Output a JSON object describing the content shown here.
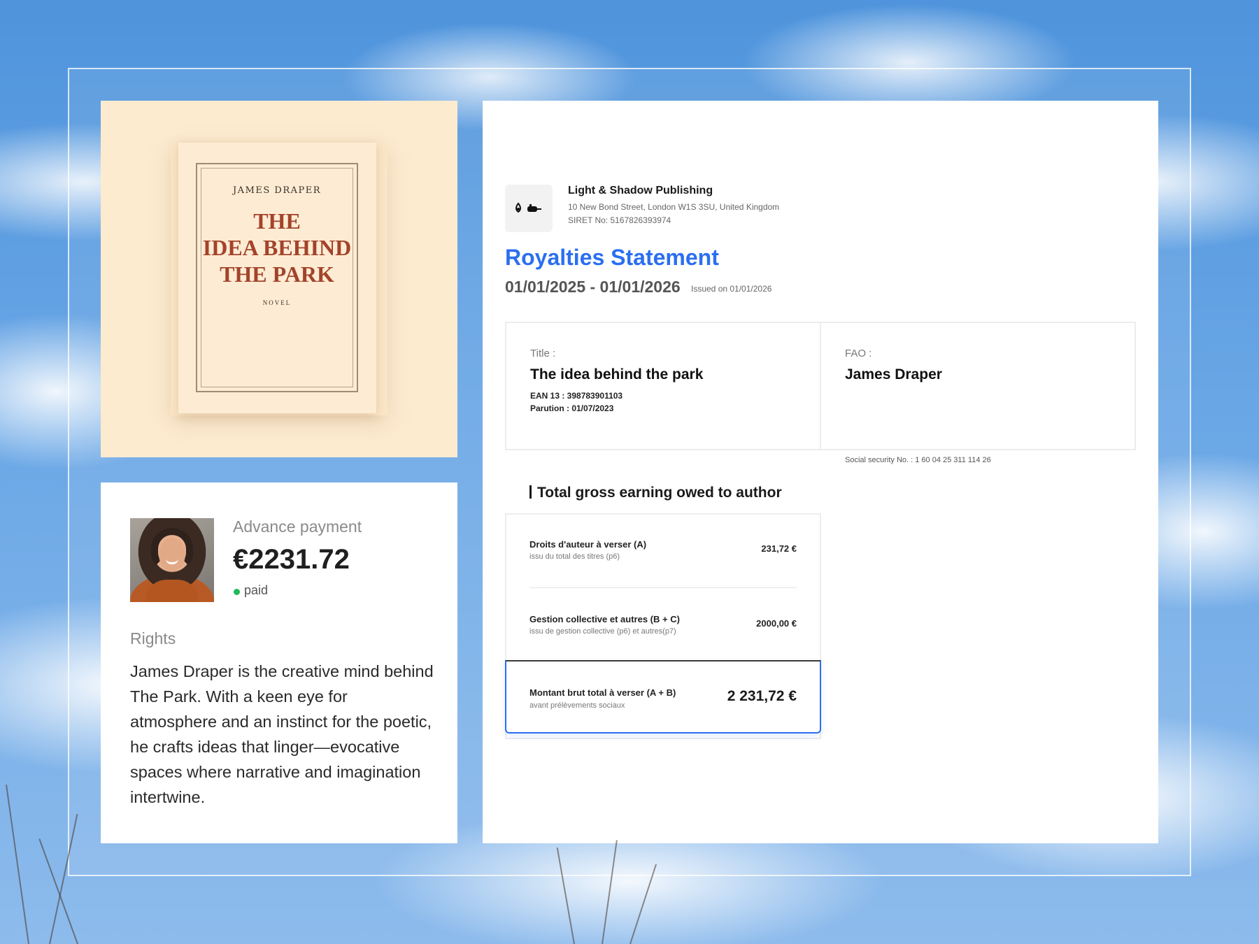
{
  "book": {
    "author": "JAMES DRAPER",
    "title": "THE\nIDEA BEHIND\nTHE PARK",
    "genre": "NOVEL"
  },
  "advance": {
    "label": "Advance payment",
    "amount": "€2231.72",
    "status": "paid",
    "status_color": "#22b95a"
  },
  "rights": {
    "label": "Rights",
    "text": "James Draper is the creative mind behind The Park. With a keen eye for atmosphere and an instinct for the poetic, he crafts ideas that linger—evocative spaces where narrative and imagination intertwine."
  },
  "publisher": {
    "name": "Light & Shadow Publishing",
    "address": "10 New Bond Street, London W1S 3SU, United Kingdom",
    "siret": "SIRET No: 5167826393974"
  },
  "statement": {
    "title": "Royalties Statement",
    "period": "01/01/2025 - 01/01/2026",
    "issued": "Issued on 01/01/2026",
    "accent_color": "#2b6ff0"
  },
  "title_card": {
    "label": "Title :",
    "value": "The idea behind the park",
    "ean": "EAN 13 : 398783901103",
    "parution": "Parution : 01/07/2023"
  },
  "fao_card": {
    "label": "FAO :",
    "value": "James Draper",
    "ssn": "Social security No. : 1 60 04 25 311 114 26"
  },
  "earnings": {
    "heading": "Total gross earning owed to author",
    "rows": [
      {
        "label": "Droits d'auteur à verser (A)",
        "sub": "issu du total des titres (p6)",
        "amount": "231,72 €"
      },
      {
        "label": "Gestion collective et autres (B + C)",
        "sub": "issu de gestion collective (p6) et autres(p7)",
        "amount": "2000,00 €"
      }
    ],
    "total": {
      "label": "Montant brut total à verser (A + B)",
      "sub": "avant prélèvements sociaux",
      "amount": "2 231,72 €"
    }
  }
}
